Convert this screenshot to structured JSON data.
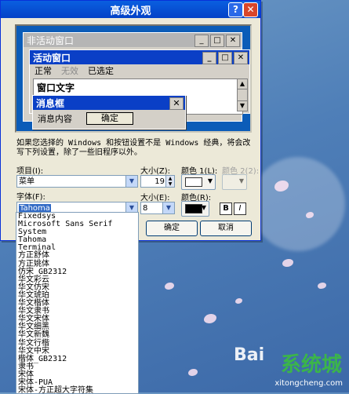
{
  "dialog": {
    "title": "高级外观",
    "help": "?",
    "close": "✕"
  },
  "preview": {
    "inactive_title": "非活动窗口",
    "active_title": "活动窗口",
    "menu": [
      "正常",
      "无效",
      "已选定"
    ],
    "window_text": "窗口文字",
    "message_box_title": "消息框",
    "message_text": "消息内容",
    "ok": "确定"
  },
  "description": "如果您选择的 Windows 和按钮设置不是 Windows 经典，将会改写下列设置，除了一些旧程序以外。",
  "form": {
    "item_label": "项目(I):",
    "item_value": "菜单",
    "size_label": "大小(Z):",
    "size_value": "19",
    "color1_label": "颜色 1(L):",
    "color2_label": "颜色 2(2):",
    "font_label": "字体(F):",
    "font_value": "Tahoma",
    "font_size_label": "大小(E):",
    "font_size_value": "8",
    "font_color_label": "颜色(R):",
    "bold": "B",
    "italic": "I",
    "ok": "确定",
    "cancel": "取消",
    "color1": "#ffffff",
    "font_color": "#000000"
  },
  "font_list": [
    "Fixedsys",
    "Microsoft Sans Serif",
    "System",
    "Tahoma",
    "Terminal",
    "方正舒体",
    "方正姚体",
    "仿宋_GB2312",
    "华文彩云",
    "华文仿宋",
    "华文琥珀",
    "华文楷体",
    "华文隶书",
    "华文宋体",
    "华文细黑",
    "华文新魏",
    "华文行楷",
    "华文中宋",
    "楷体_GB2312",
    "隶书",
    "宋体",
    "宋体-PUA",
    "宋体-方正超大字符集",
    "微软雅黑"
  ],
  "watermark": {
    "brand": "Bai",
    "badge": "系统城",
    "url": "xitongcheng.com"
  }
}
